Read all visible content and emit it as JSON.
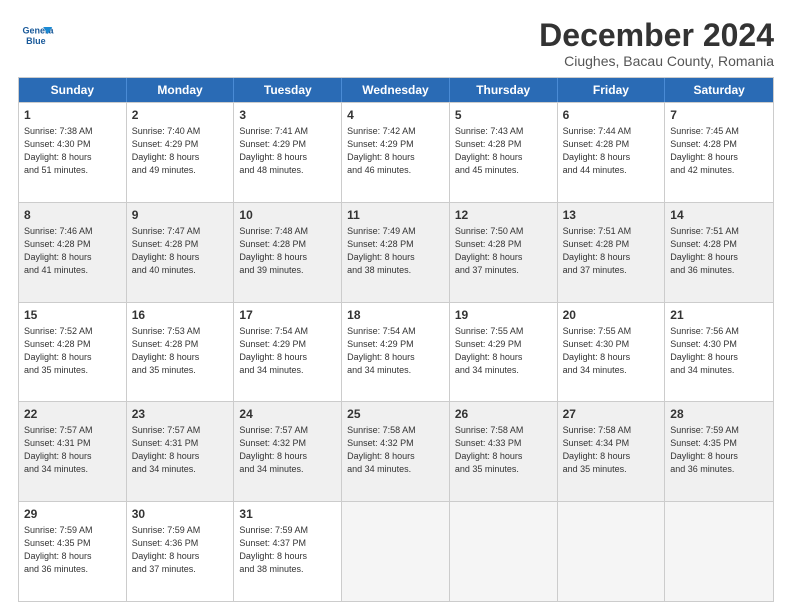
{
  "logo": {
    "line1": "General",
    "line2": "Blue"
  },
  "title": "December 2024",
  "subtitle": "Ciughes, Bacau County, Romania",
  "headers": [
    "Sunday",
    "Monday",
    "Tuesday",
    "Wednesday",
    "Thursday",
    "Friday",
    "Saturday"
  ],
  "weeks": [
    [
      {
        "day": "1",
        "info": "Sunrise: 7:38 AM\nSunset: 4:30 PM\nDaylight: 8 hours\nand 51 minutes."
      },
      {
        "day": "2",
        "info": "Sunrise: 7:40 AM\nSunset: 4:29 PM\nDaylight: 8 hours\nand 49 minutes."
      },
      {
        "day": "3",
        "info": "Sunrise: 7:41 AM\nSunset: 4:29 PM\nDaylight: 8 hours\nand 48 minutes."
      },
      {
        "day": "4",
        "info": "Sunrise: 7:42 AM\nSunset: 4:29 PM\nDaylight: 8 hours\nand 46 minutes."
      },
      {
        "day": "5",
        "info": "Sunrise: 7:43 AM\nSunset: 4:28 PM\nDaylight: 8 hours\nand 45 minutes."
      },
      {
        "day": "6",
        "info": "Sunrise: 7:44 AM\nSunset: 4:28 PM\nDaylight: 8 hours\nand 44 minutes."
      },
      {
        "day": "7",
        "info": "Sunrise: 7:45 AM\nSunset: 4:28 PM\nDaylight: 8 hours\nand 42 minutes."
      }
    ],
    [
      {
        "day": "8",
        "info": "Sunrise: 7:46 AM\nSunset: 4:28 PM\nDaylight: 8 hours\nand 41 minutes."
      },
      {
        "day": "9",
        "info": "Sunrise: 7:47 AM\nSunset: 4:28 PM\nDaylight: 8 hours\nand 40 minutes."
      },
      {
        "day": "10",
        "info": "Sunrise: 7:48 AM\nSunset: 4:28 PM\nDaylight: 8 hours\nand 39 minutes."
      },
      {
        "day": "11",
        "info": "Sunrise: 7:49 AM\nSunset: 4:28 PM\nDaylight: 8 hours\nand 38 minutes."
      },
      {
        "day": "12",
        "info": "Sunrise: 7:50 AM\nSunset: 4:28 PM\nDaylight: 8 hours\nand 37 minutes."
      },
      {
        "day": "13",
        "info": "Sunrise: 7:51 AM\nSunset: 4:28 PM\nDaylight: 8 hours\nand 37 minutes."
      },
      {
        "day": "14",
        "info": "Sunrise: 7:51 AM\nSunset: 4:28 PM\nDaylight: 8 hours\nand 36 minutes."
      }
    ],
    [
      {
        "day": "15",
        "info": "Sunrise: 7:52 AM\nSunset: 4:28 PM\nDaylight: 8 hours\nand 35 minutes."
      },
      {
        "day": "16",
        "info": "Sunrise: 7:53 AM\nSunset: 4:28 PM\nDaylight: 8 hours\nand 35 minutes."
      },
      {
        "day": "17",
        "info": "Sunrise: 7:54 AM\nSunset: 4:29 PM\nDaylight: 8 hours\nand 34 minutes."
      },
      {
        "day": "18",
        "info": "Sunrise: 7:54 AM\nSunset: 4:29 PM\nDaylight: 8 hours\nand 34 minutes."
      },
      {
        "day": "19",
        "info": "Sunrise: 7:55 AM\nSunset: 4:29 PM\nDaylight: 8 hours\nand 34 minutes."
      },
      {
        "day": "20",
        "info": "Sunrise: 7:55 AM\nSunset: 4:30 PM\nDaylight: 8 hours\nand 34 minutes."
      },
      {
        "day": "21",
        "info": "Sunrise: 7:56 AM\nSunset: 4:30 PM\nDaylight: 8 hours\nand 34 minutes."
      }
    ],
    [
      {
        "day": "22",
        "info": "Sunrise: 7:57 AM\nSunset: 4:31 PM\nDaylight: 8 hours\nand 34 minutes."
      },
      {
        "day": "23",
        "info": "Sunrise: 7:57 AM\nSunset: 4:31 PM\nDaylight: 8 hours\nand 34 minutes."
      },
      {
        "day": "24",
        "info": "Sunrise: 7:57 AM\nSunset: 4:32 PM\nDaylight: 8 hours\nand 34 minutes."
      },
      {
        "day": "25",
        "info": "Sunrise: 7:58 AM\nSunset: 4:32 PM\nDaylight: 8 hours\nand 34 minutes."
      },
      {
        "day": "26",
        "info": "Sunrise: 7:58 AM\nSunset: 4:33 PM\nDaylight: 8 hours\nand 35 minutes."
      },
      {
        "day": "27",
        "info": "Sunrise: 7:58 AM\nSunset: 4:34 PM\nDaylight: 8 hours\nand 35 minutes."
      },
      {
        "day": "28",
        "info": "Sunrise: 7:59 AM\nSunset: 4:35 PM\nDaylight: 8 hours\nand 36 minutes."
      }
    ],
    [
      {
        "day": "29",
        "info": "Sunrise: 7:59 AM\nSunset: 4:35 PM\nDaylight: 8 hours\nand 36 minutes."
      },
      {
        "day": "30",
        "info": "Sunrise: 7:59 AM\nSunset: 4:36 PM\nDaylight: 8 hours\nand 37 minutes."
      },
      {
        "day": "31",
        "info": "Sunrise: 7:59 AM\nSunset: 4:37 PM\nDaylight: 8 hours\nand 38 minutes."
      },
      {
        "day": "",
        "info": ""
      },
      {
        "day": "",
        "info": ""
      },
      {
        "day": "",
        "info": ""
      },
      {
        "day": "",
        "info": ""
      }
    ]
  ]
}
